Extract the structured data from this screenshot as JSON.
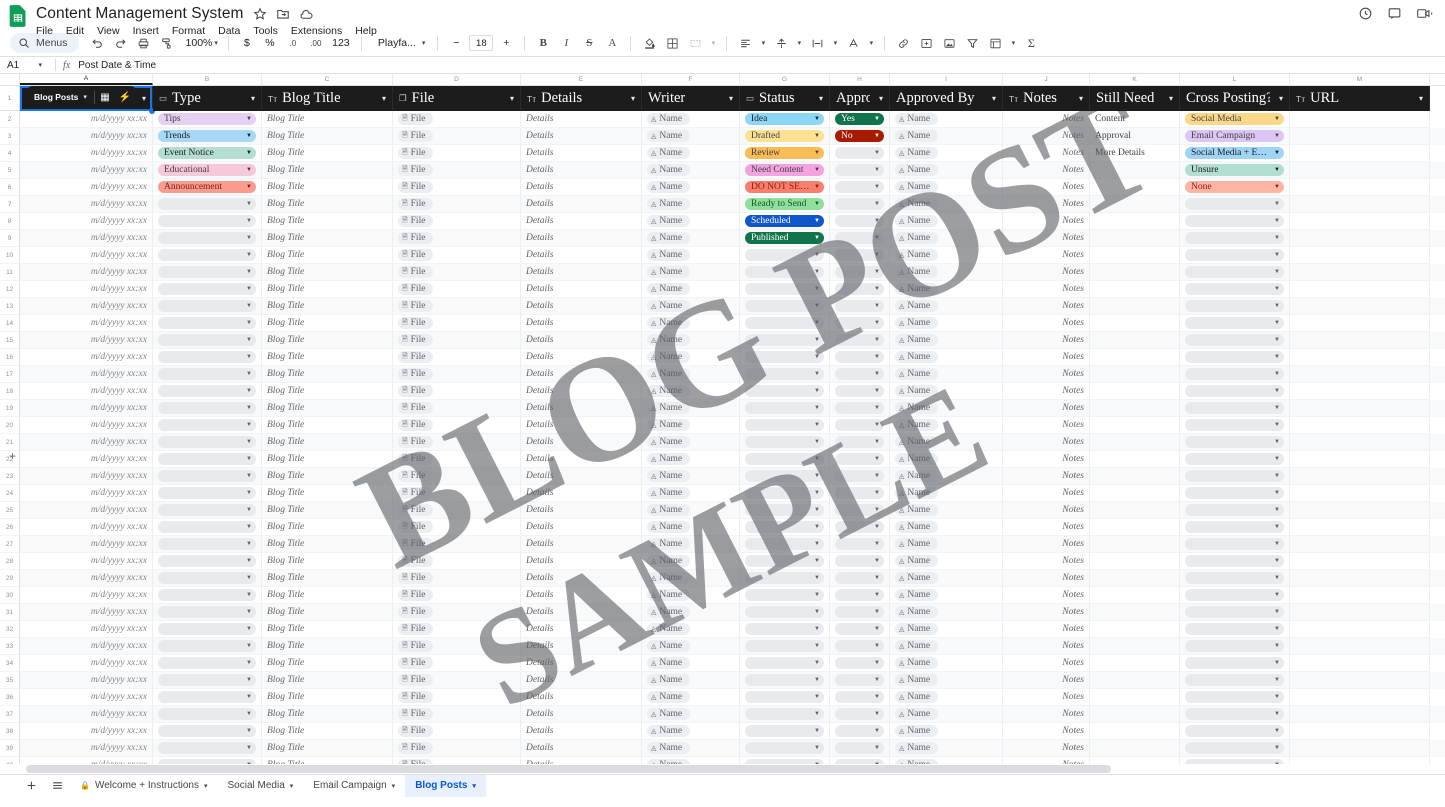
{
  "app": {
    "doc_title": "Content Management System",
    "title_icons": [
      "star-icon",
      "folder-move-icon",
      "cloud-saved-icon"
    ],
    "menus": [
      "File",
      "Edit",
      "View",
      "Insert",
      "Format",
      "Data",
      "Tools",
      "Extensions",
      "Help"
    ],
    "top_right_icons": [
      "version-history-icon",
      "comment-icon",
      "meet-icon"
    ]
  },
  "toolbar": {
    "menus_label": "Menus",
    "zoom": "100%",
    "currency_label": "$",
    "percent_label": "%",
    "dec_less_label": ".0",
    "dec_more_label": ".00",
    "formats_label": "123",
    "font_name": "Playfa...",
    "font_size": "18",
    "minus": "−",
    "plus": "+",
    "bold": "B",
    "italic": "I",
    "strike": "S",
    "text_color": "A",
    "icons": [
      "undo-icon",
      "redo-icon",
      "print-icon",
      "paint-format-icon",
      "fill-color-icon",
      "borders-icon",
      "merge-cells-icon",
      "horizontal-align-icon",
      "vertical-align-icon",
      "text-wrap-icon",
      "text-rotation-icon",
      "insert-link-icon",
      "insert-comment-icon",
      "insert-image-icon",
      "create-filter-icon",
      "filter-views-icon",
      "functions-icon"
    ]
  },
  "formula_bar": {
    "name_box": "A1",
    "fx_label": "fx",
    "value": "Post Date & Time"
  },
  "grid": {
    "column_letters": [
      "A",
      "B",
      "C",
      "D",
      "E",
      "F",
      "G",
      "H",
      "I",
      "J",
      "K",
      "L",
      "M"
    ],
    "selected_column": "A",
    "row_count": 39,
    "first_row_number": 1,
    "sheet_chip": {
      "label": "Blog Posts",
      "caret": "⌄",
      "icons": [
        "table-icon",
        "bolt-icon"
      ]
    },
    "headers": [
      {
        "label": "Post Date & Time",
        "icon": "",
        "caret": "⌄"
      },
      {
        "label": "Type",
        "icon": "▭",
        "caret": "⌄"
      },
      {
        "label": "Blog Title",
        "icon": "Tт",
        "caret": "⌄"
      },
      {
        "label": "File",
        "icon": "❐",
        "caret": "⌄"
      },
      {
        "label": "Details",
        "icon": "Tт",
        "caret": "⌄"
      },
      {
        "label": "Writer",
        "icon": "",
        "caret": "⌄"
      },
      {
        "label": "Status",
        "icon": "▭",
        "caret": "⌄"
      },
      {
        "label": "Approve",
        "icon": "",
        "caret": "⌄"
      },
      {
        "label": "Approved By",
        "icon": "",
        "caret": "⌄"
      },
      {
        "label": "Notes",
        "icon": "Tт",
        "caret": "⌄"
      },
      {
        "label": "Still Need",
        "icon": "",
        "caret": "⌄"
      },
      {
        "label": "Cross Posting?",
        "icon": "",
        "caret": "⌄"
      },
      {
        "label": "URL",
        "icon": "Tт",
        "caret": "⌄"
      }
    ],
    "placeholders": {
      "date": "m/d/yyyy xx:xx",
      "blog_title": "Blog Title",
      "file": "File",
      "details": "Details",
      "name": "Name",
      "notes": "Notes"
    },
    "type_values": [
      {
        "text": "Tips",
        "bg": "#e5cff2",
        "fg": "#3f3f3f"
      },
      {
        "text": "Trends",
        "bg": "#a7d8f5",
        "fg": "#1a1a1a"
      },
      {
        "text": "Event Notice",
        "bg": "#b3ded4",
        "fg": "#1a1a1a"
      },
      {
        "text": "Educational",
        "bg": "#f7c8dc",
        "fg": "#3f3f3f"
      },
      {
        "text": "Announcement",
        "bg": "#fa9b8f",
        "fg": "#7a1f12"
      }
    ],
    "status_values": [
      {
        "text": "Idea",
        "bg": "#8ed6f8",
        "fg": "#1a1a1a"
      },
      {
        "text": "Drafted",
        "bg": "#fde293",
        "fg": "#3f3f3f"
      },
      {
        "text": "Review",
        "bg": "#fbbc56",
        "fg": "#3f3f3f"
      },
      {
        "text": "Need Content",
        "bg": "#f5a3e0",
        "fg": "#3f3f3f"
      },
      {
        "text": "DO NOT SEND",
        "bg": "#f87e6d",
        "fg": "#8c1d0a"
      },
      {
        "text": "Ready to Send",
        "bg": "#8fe09a",
        "fg": "#14532d"
      },
      {
        "text": "Scheduled",
        "bg": "#1155cc",
        "fg": "#ffffff"
      },
      {
        "text": "Published",
        "bg": "#11734b",
        "fg": "#ffffff"
      }
    ],
    "approve_values": [
      {
        "text": "Yes",
        "bg": "#11734b",
        "fg": "#ffffff"
      },
      {
        "text": "No",
        "bg": "#a61c00",
        "fg": "#ffffff"
      }
    ],
    "still_need_values": [
      "Content",
      "Approval",
      "More Details"
    ],
    "cross_posting_values": [
      {
        "text": "Social Media",
        "bg": "#fbd78a",
        "fg": "#3f3f3f"
      },
      {
        "text": "Email Campaign",
        "bg": "#ddc5f5",
        "fg": "#3f3f3f"
      },
      {
        "text": "Social Media + Email",
        "bg": "#9fd4f7",
        "fg": "#1a1a1a"
      },
      {
        "text": "Unsure",
        "bg": "#b3ded4",
        "fg": "#1a1a1a"
      },
      {
        "text": "None",
        "bg": "#fcb4a5",
        "fg": "#8c1d0a"
      }
    ],
    "watermark": {
      "line1": "BLOG POST",
      "line2": "SAMPLE"
    }
  },
  "bottom": {
    "add_sheet_label": "+",
    "all_sheets_label": "≡",
    "tabs": [
      {
        "label": "Welcome + Instructions",
        "locked": true,
        "active": false
      },
      {
        "label": "Social Media",
        "locked": false,
        "active": false
      },
      {
        "label": "Email Campaign",
        "locked": false,
        "active": false
      },
      {
        "label": "Blog Posts",
        "locked": false,
        "active": true
      }
    ]
  }
}
